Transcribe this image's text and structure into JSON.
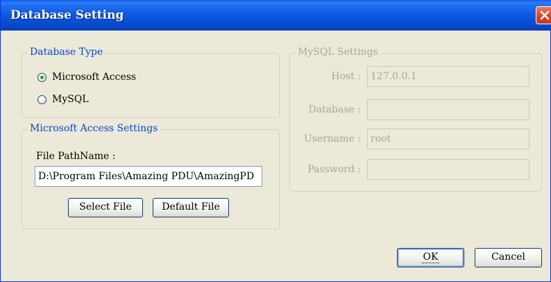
{
  "window": {
    "title": "Database Setting"
  },
  "database_type": {
    "legend": "Database Type",
    "options": [
      {
        "label": "Microsoft Access",
        "selected": true
      },
      {
        "label": "MySQL",
        "selected": false
      }
    ]
  },
  "access_settings": {
    "legend": "Microsoft Access Settings",
    "file_path_label": "File PathName :",
    "file_path_value": "D:\\Program Files\\Amazing PDU\\AmazingPD",
    "select_file_label": "Select File",
    "default_file_label": "Default File"
  },
  "mysql_settings": {
    "legend": "MySQL Settings",
    "host_label": "Host :",
    "host_value": "127.0.0.1",
    "database_label": "Database :",
    "database_value": "",
    "username_label": "Username :",
    "username_value": "root",
    "password_label": "Password :",
    "password_value": ""
  },
  "buttons": {
    "ok_label": "OK",
    "cancel_label": "Cancel"
  },
  "colors": {
    "title_bar": "#0a55e0",
    "group_legend": "#0046d5",
    "disabled_text": "#a6a69a",
    "close_button": "#d2452a"
  }
}
